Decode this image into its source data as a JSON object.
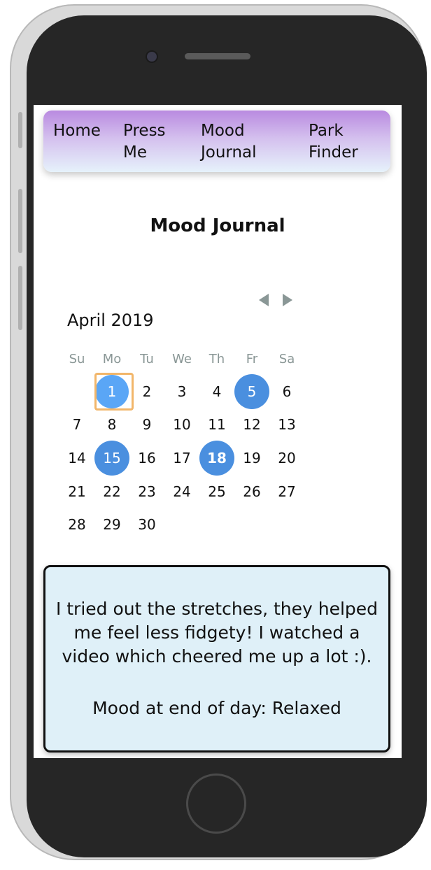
{
  "nav": {
    "items": [
      {
        "label": "Home"
      },
      {
        "label": "Press\nMe"
      },
      {
        "label": "Mood\nJournal"
      },
      {
        "label": "Park\nFinder"
      }
    ]
  },
  "page": {
    "title": "Mood Journal"
  },
  "calendar": {
    "month_label": "April 2019",
    "weekdays": [
      "Su",
      "Mo",
      "Tu",
      "We",
      "Th",
      "Fr",
      "Sa"
    ],
    "weeks": [
      [
        "",
        "1",
        "2",
        "3",
        "4",
        "5",
        "6"
      ],
      [
        "7",
        "8",
        "9",
        "10",
        "11",
        "12",
        "13"
      ],
      [
        "14",
        "15",
        "16",
        "17",
        "18",
        "19",
        "20"
      ],
      [
        "21",
        "22",
        "23",
        "24",
        "25",
        "26",
        "27"
      ],
      [
        "28",
        "29",
        "30",
        "",
        "",
        "",
        ""
      ]
    ],
    "marked_days": [
      "1",
      "5",
      "15",
      "18"
    ],
    "selected_day": "1",
    "today": "18"
  },
  "entry": {
    "text": "I tried out the stretches, they helped me feel less fidgety! I watched a video which cheered me up a lot :).",
    "mood": "Mood at end of day: Relaxed"
  },
  "colors": {
    "marked": "#4a8fdf",
    "selected_outline": "#f2b66a",
    "entry_bg": "#dff0f8"
  }
}
